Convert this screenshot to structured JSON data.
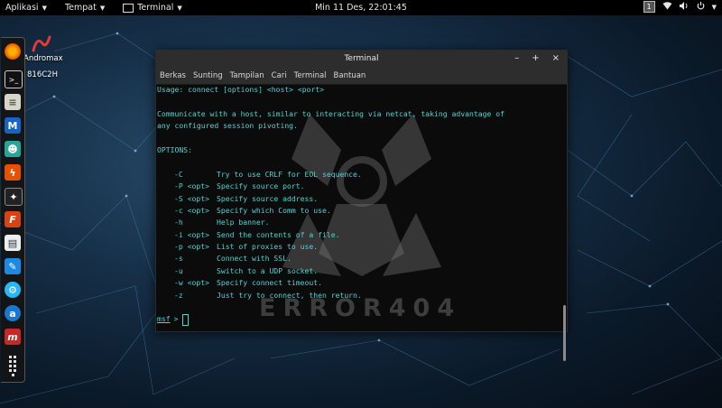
{
  "topbar": {
    "apps_menu": "Aplikasi",
    "places_menu": "Tempat",
    "terminal_menu": "Terminal",
    "clock": "Min 11 Des, 22:01:45",
    "workspace": "1"
  },
  "desktop_icons": [
    {
      "label": "Andromax"
    },
    {
      "label": "816C2H"
    }
  ],
  "terminal": {
    "title": "Terminal",
    "minimize": "–",
    "maximize": "+",
    "close": "×",
    "menu": [
      "Berkas",
      "Sunting",
      "Tampilan",
      "Cari",
      "Terminal",
      "Bantuan"
    ],
    "usage": "Usage: connect [options] <host> <port>",
    "desc1": "Communicate with a host, similar to interacting via netcat, taking advantage of",
    "desc2": "any configured session pivoting.",
    "options_header": "OPTIONS:",
    "options": [
      {
        "flag": "-C",
        "desc": "Try to use CRLF for EOL sequence."
      },
      {
        "flag": "-P <opt>",
        "desc": "Specify source port."
      },
      {
        "flag": "-S <opt>",
        "desc": "Specify source address."
      },
      {
        "flag": "-c <opt>",
        "desc": "Specify which Comm to use."
      },
      {
        "flag": "-h",
        "desc": "Help banner."
      },
      {
        "flag": "-i <opt>",
        "desc": "Send the contents of a file."
      },
      {
        "flag": "-p <opt>",
        "desc": "List of proxies to use."
      },
      {
        "flag": "-s",
        "desc": "Connect with SSL."
      },
      {
        "flag": "-u",
        "desc": "Switch to a UDP socket."
      },
      {
        "flag": "-w <opt>",
        "desc": "Specify connect timeout."
      },
      {
        "flag": "-z",
        "desc": "Just try to connect, then return."
      }
    ],
    "prompt": "msf",
    "prompt_symbol": ">",
    "watermark": "ERROR404"
  },
  "colors": {
    "terminal_text": "#4fd3d3",
    "topbar_bg": "#000000",
    "titlebar_bg": "#2d2d2d"
  }
}
